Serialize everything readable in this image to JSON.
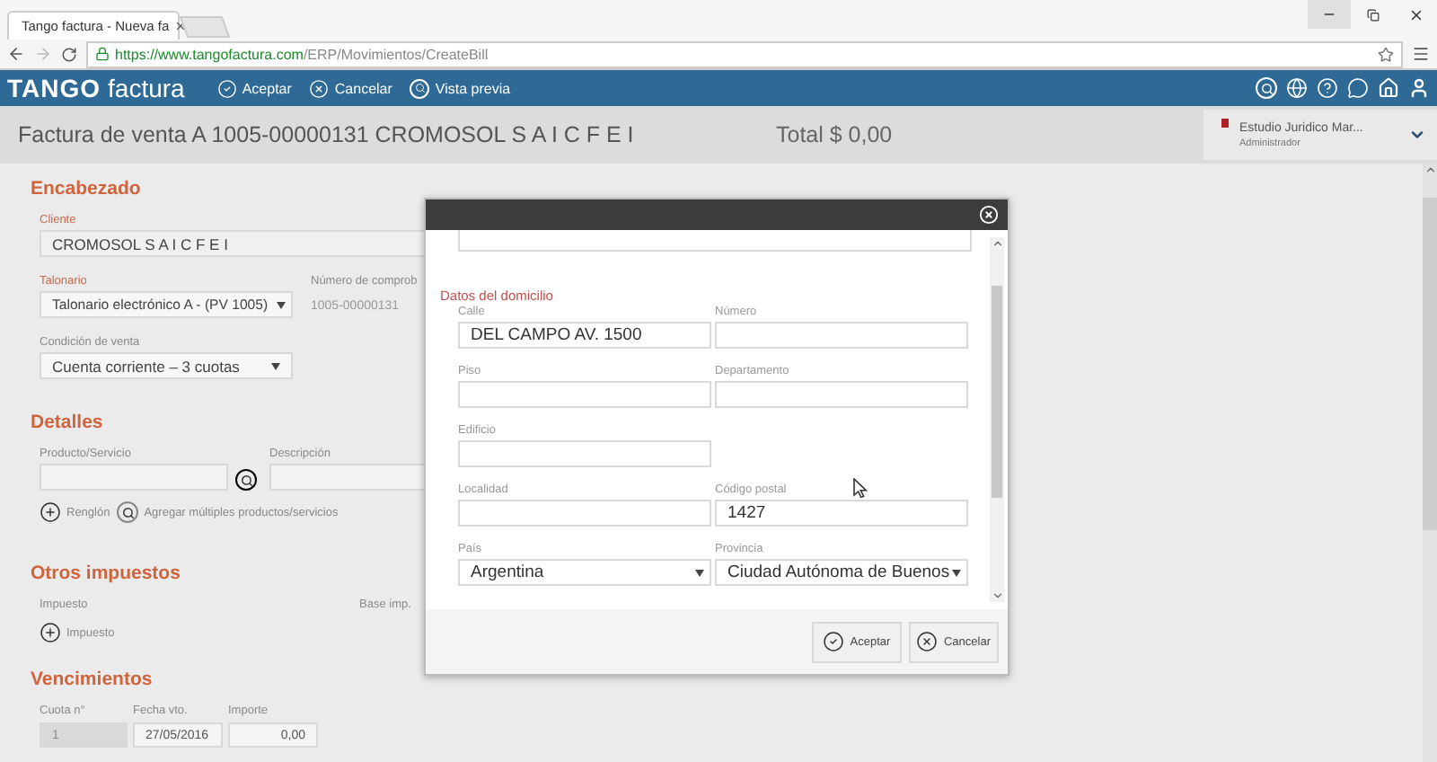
{
  "browser": {
    "tab_title": "Tango factura - Nueva fa",
    "url_host": "https://www.tangofactura.com",
    "url_path": "/ERP/Movimientos/CreateBill"
  },
  "app": {
    "logo": "TANGO",
    "product": "factura",
    "actions": [
      {
        "kind": "accept",
        "label": "Aceptar"
      },
      {
        "kind": "cancel",
        "label": "Cancelar"
      },
      {
        "kind": "preview",
        "label": "Vista previa"
      }
    ]
  },
  "document": {
    "title": "Factura de venta A 1005-00000131 CROMOSOL S A I C F E I",
    "total": "Total $ 0,00"
  },
  "user": {
    "company": "Estudio Juridico Mar...",
    "role": "Administrador"
  },
  "encabezado": {
    "title": "Encabezado",
    "cliente": {
      "label": "Cliente",
      "value": "CROMOSOL S A I C F E I"
    },
    "talonario": {
      "label": "Talonario",
      "value": "Talonario electrónico A - (PV 1005)"
    },
    "numero": {
      "label": "Número de comprob",
      "value": "1005-00000131"
    },
    "condicion": {
      "label": "Condición de venta",
      "value": "Cuenta corriente – 3 cuotas"
    }
  },
  "detalles": {
    "title": "Detalles",
    "producto_label": "Producto/Servicio",
    "descripcion_label": "Descripción",
    "actions": [
      {
        "kind": "add",
        "label": "Renglón"
      },
      {
        "kind": "search",
        "label": "Agregar múltiples productos/servicios"
      }
    ]
  },
  "otros_impuestos": {
    "title": "Otros impuestos",
    "impuesto_label": "Impuesto",
    "base_label": "Base imp.",
    "actions": [
      {
        "kind": "add",
        "label": "Impuesto"
      }
    ]
  },
  "vencimientos": {
    "title": "Vencimientos",
    "columns": [
      "Cuota n°",
      "Fecha vto.",
      "Importe"
    ],
    "rows": [
      [
        {
          "value": "1",
          "disabled": true
        },
        {
          "value": "27/05/2016",
          "disabled": false
        },
        {
          "value": "0,00",
          "disabled": false
        }
      ]
    ]
  },
  "dialog": {
    "section": "Datos del domicilio",
    "rows": [
      [
        {
          "label": "Calle",
          "value": "DEL CAMPO AV. 1500",
          "kind": "text"
        },
        {
          "label": "Número",
          "kind": "text"
        }
      ],
      [
        {
          "label": "Piso",
          "kind": "text"
        },
        {
          "label": "Departamento",
          "kind": "text"
        }
      ],
      [
        {
          "label": "Edificio",
          "kind": "text"
        }
      ],
      [
        {
          "label": "Localidad",
          "kind": "text"
        },
        {
          "label": "Código postal",
          "value": "1427",
          "kind": "text"
        }
      ],
      [
        {
          "label": "País",
          "value": "Argentina",
          "kind": "select"
        },
        {
          "label": "Provincia",
          "value": "Ciudad Autónoma de Buenos",
          "kind": "select"
        }
      ]
    ],
    "buttons": [
      {
        "kind": "accept",
        "label": "Aceptar"
      },
      {
        "kind": "cancel",
        "label": "Cancelar"
      }
    ]
  }
}
